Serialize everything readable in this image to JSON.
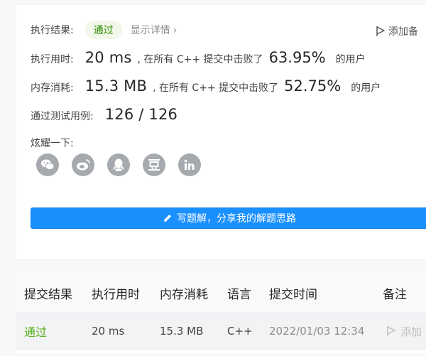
{
  "result": {
    "label": "执行结果:",
    "status": "通过",
    "detail": "显示详情",
    "add_note": "添加备"
  },
  "runtime": {
    "label": "执行用时:",
    "value": "20 ms",
    "beat_text": ", 在所有 C++ 提交中击败了",
    "percent": "63.95%",
    "suffix": "的用户"
  },
  "memory": {
    "label": "内存消耗:",
    "value": "15.3 MB",
    "beat_text": ", 在所有 C++ 提交中击败了",
    "percent": "52.75%",
    "suffix": "的用户"
  },
  "tests": {
    "label": "通过测试用例:",
    "value": "126 / 126"
  },
  "share": {
    "label": "炫耀一下:",
    "icons": [
      "wechat-icon",
      "weibo-icon",
      "qq-icon",
      "douban-icon",
      "linkedin-icon"
    ]
  },
  "write_solution": "写题解，分享我的解题思路",
  "table": {
    "headers": [
      "提交结果",
      "执行用时",
      "内存消耗",
      "语言",
      "提交时间",
      "备注"
    ],
    "rows": [
      {
        "result": "通过",
        "runtime": "20 ms",
        "memory": "15.3 MB",
        "lang": "C++",
        "time": "2022/01/03 12:34",
        "note": "添加"
      }
    ]
  },
  "colors": {
    "accent": "#1a90ff",
    "pass": "#5cb11e",
    "icon_gray": "#a6a9ad"
  }
}
